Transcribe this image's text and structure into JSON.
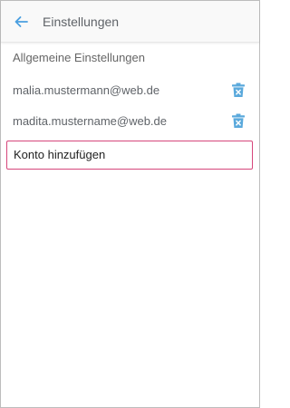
{
  "header": {
    "title": "Einstellungen",
    "back_icon": "arrow-left-icon",
    "accent_color": "#4a9fe0"
  },
  "section": {
    "label": "Allgemeine Einstellungen"
  },
  "accounts": [
    {
      "email": "malia.mustermann@web.de",
      "delete_icon": "trash-icon"
    },
    {
      "email": "madita.mustername@web.de",
      "delete_icon": "trash-icon"
    }
  ],
  "add_account": {
    "label": "Konto hinzufügen",
    "border_color": "#d6467b"
  }
}
